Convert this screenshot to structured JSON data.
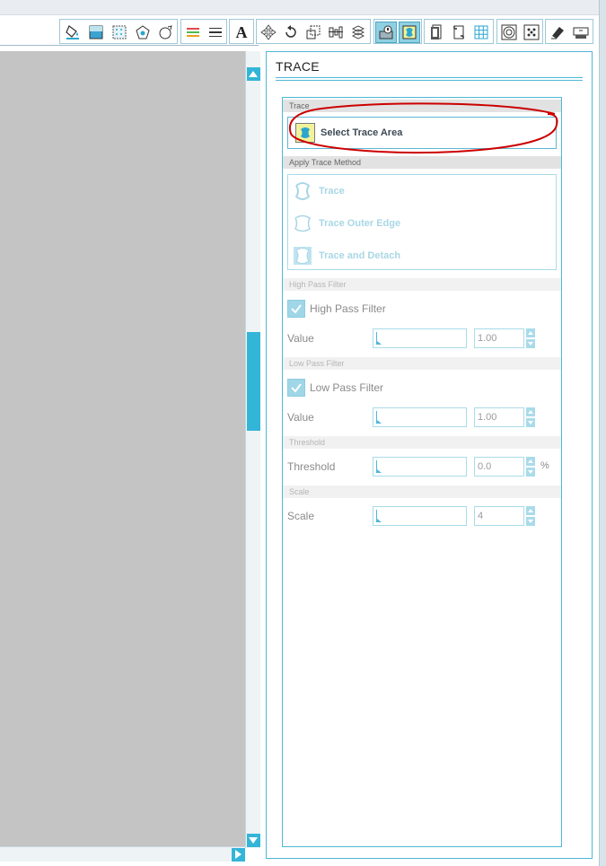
{
  "toolbar": {
    "icons": [
      "paint-bucket-icon",
      "fill-panel-icon",
      "pattern-icon",
      "shape-edit-icon",
      "offset-icon",
      "line-color-icon",
      "line-style-icon",
      "text-icon",
      "move-icon",
      "rotate-icon",
      "scale-icon",
      "align-icon",
      "replicate-icon",
      "knife-icon",
      "trace-icon",
      "page-setup-icon",
      "registration-icon",
      "grid-icon",
      "offset-rings-icon",
      "dots-icon",
      "eraser-icon",
      "send-to-cutter-icon"
    ],
    "active": [
      "knife-icon",
      "trace-icon"
    ],
    "text_tool_glyph": "A"
  },
  "panel": {
    "title": "TRACE",
    "sections": {
      "trace": "Trace",
      "apply_method": "Apply Trace Method",
      "high_pass": "High Pass Filter",
      "low_pass": "Low Pass Filter",
      "threshold": "Threshold",
      "scale": "Scale"
    },
    "select_trace_area": "Select Trace Area",
    "methods": {
      "trace": "Trace",
      "outer_edge": "Trace Outer Edge",
      "detach": "Trace and Detach"
    },
    "high_pass": {
      "checkbox": "High Pass Filter",
      "checked": true,
      "value_label": "Value",
      "value": "1.00"
    },
    "low_pass": {
      "checkbox": "Low Pass Filter",
      "checked": true,
      "value_label": "Value",
      "value": "1.00"
    },
    "threshold": {
      "label": "Threshold",
      "value": "0.0",
      "unit": "%"
    },
    "scale": {
      "label": "Scale",
      "value": "4"
    }
  },
  "colors": {
    "accent": "#33b5d8",
    "panel_border": "#4fb7d6",
    "canvas": "#c4c4c4",
    "annotation": "#cc0000"
  }
}
